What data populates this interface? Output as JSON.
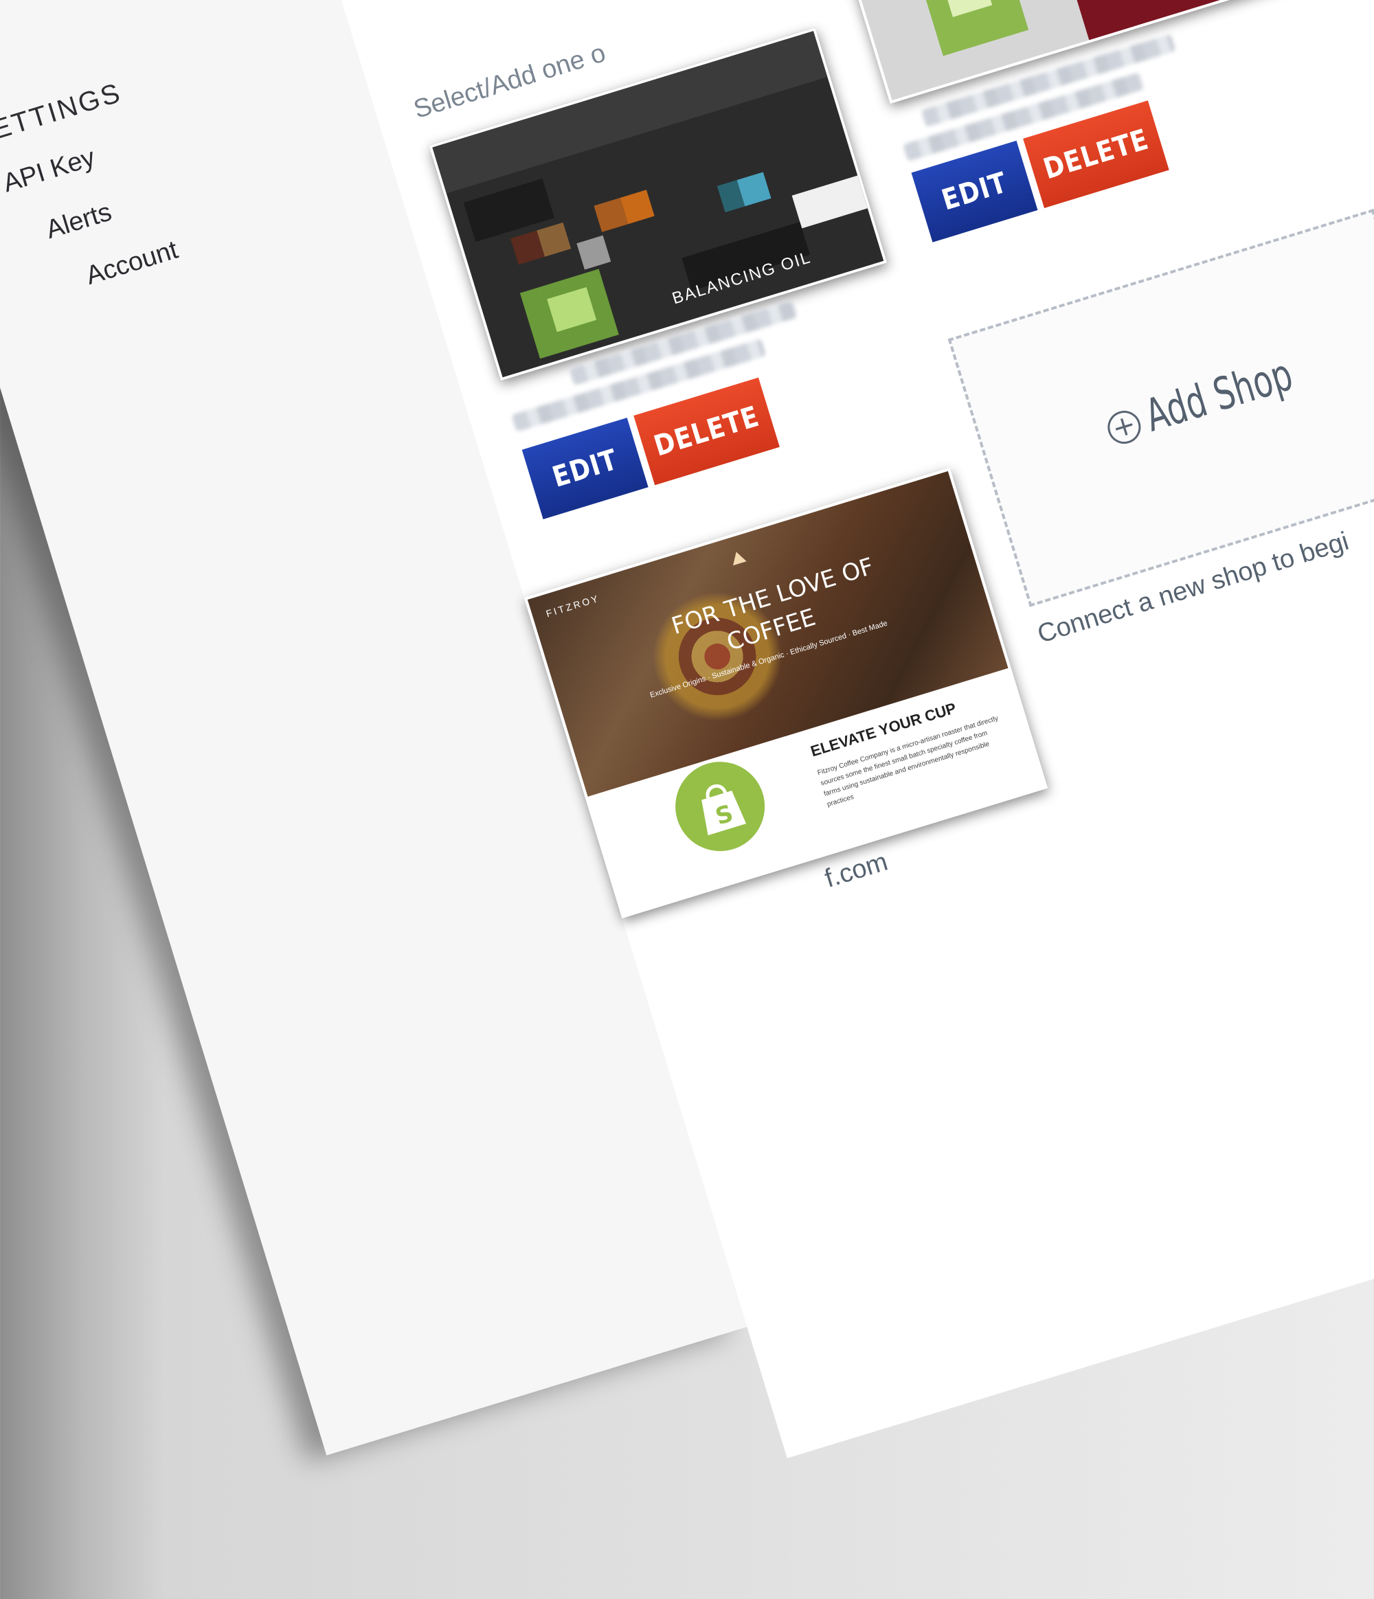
{
  "sidebar": {
    "heading": "SETTINGS",
    "items": [
      {
        "label": "API Key"
      },
      {
        "label": "Alerts"
      },
      {
        "label": "Account"
      }
    ]
  },
  "main": {
    "intro": "Select/Add one o",
    "shops": [
      {
        "edit_label": "EDIT",
        "delete_label": "DELETE",
        "screenshot_caption": "BALANCING OIL"
      },
      {
        "edit_label": "EDIT",
        "delete_label": "DELETE"
      },
      {
        "brand": "FITZROY",
        "headline_line1": "FOR THE LOVE OF",
        "headline_line2": "COFFEE",
        "tagline": "Exclusive Origins · Sustainable & Organic · Ethically Sourced · Best Made",
        "section_title": "ELEVATE YOUR CUP",
        "body": "Fitzroy Coffee Company is a micro-artisan roaster that directly sources some the finest small batch specialty coffee from farms using sustainable and environmentally responsible practices",
        "domain_fragment": "f.com",
        "platform_icon": "shopify-bag-icon"
      }
    ],
    "add_shop": {
      "label": "Add Shop",
      "subtitle": "Connect a new shop to begi"
    }
  },
  "colors": {
    "edit": "#1c3a9e",
    "delete": "#e0401f",
    "shopify": "#95bf47"
  }
}
